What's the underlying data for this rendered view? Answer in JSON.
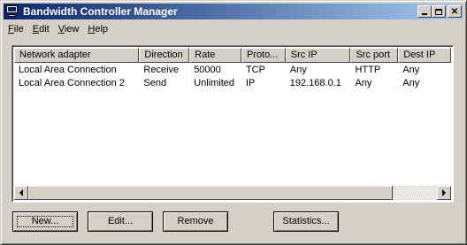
{
  "window": {
    "title": "Bandwidth Controller Manager",
    "icon": "network-monitor-icon",
    "titlebar_colors": [
      "#0a246a",
      "#a6caf0"
    ]
  },
  "menu": [
    {
      "label": "File",
      "key": "F"
    },
    {
      "label": "Edit",
      "key": "E"
    },
    {
      "label": "View",
      "key": "V"
    },
    {
      "label": "Help",
      "key": "H"
    }
  ],
  "table": {
    "columns": [
      "Network adapter",
      "Direction",
      "Rate",
      "Proto...",
      "Src IP",
      "Src port",
      "Dest IP"
    ],
    "rows": [
      [
        "Local Area Connection",
        "Receive",
        "50000",
        "TCP",
        "Any",
        "HTTP",
        "Any"
      ],
      [
        "Local Area Connection 2",
        "Send",
        "Unlimited",
        "IP",
        "192.168.0.1",
        "Any",
        "Any"
      ]
    ]
  },
  "buttons": {
    "new": "New...",
    "edit": "Edit...",
    "remove": "Remove",
    "statistics": "Statistics..."
  }
}
